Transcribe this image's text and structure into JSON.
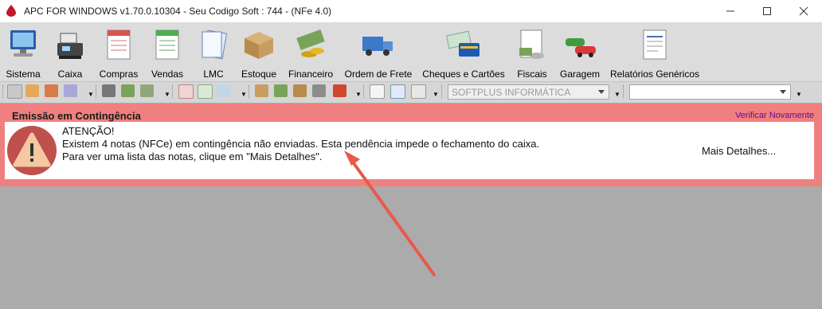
{
  "window": {
    "title": "APC FOR WINDOWS v1.70.0.10304 - Seu Codigo Soft : 744  -  (NFe 4.0)",
    "controls": [
      "minimize",
      "maximize",
      "close"
    ]
  },
  "toolbar": {
    "items": [
      {
        "label": "Sistema",
        "icon": "computer-icon"
      },
      {
        "label": "Caixa",
        "icon": "cash-register-icon"
      },
      {
        "label": "Compras",
        "icon": "purchase-form-icon"
      },
      {
        "label": "Vendas",
        "icon": "sales-sheet-icon"
      },
      {
        "label": "LMC",
        "icon": "documents-icon"
      },
      {
        "label": "Estoque",
        "icon": "box-icon"
      },
      {
        "label": "Financeiro",
        "icon": "money-icon"
      },
      {
        "label": "Ordem de Frete",
        "icon": "truck-icon"
      },
      {
        "label": "Cheques e Cartões",
        "icon": "cheque-card-icon"
      },
      {
        "label": "Fiscais",
        "icon": "fiscal-icon"
      },
      {
        "label": "Garagem",
        "icon": "cars-icon"
      },
      {
        "label": "Relatórios Genéricos",
        "icon": "report-icon"
      }
    ]
  },
  "quickbar": {
    "company_combo": "SOFTPLUS INFORMÁTICA",
    "search_combo": ""
  },
  "panel": {
    "title": "Emissão em Contingência",
    "verify_link": "Verificar Novamente",
    "message_heading": "ATENÇÃO!",
    "message_line1": "Existem 4 notas (NFCe) em contingência não enviadas. Esta pendência impede o fechamento do caixa.",
    "message_line2": "Para ver uma lista das notas, clique em \"Mais Detalhes\".",
    "details_button": "Mais Detalhes...",
    "colors": {
      "panel_bg": "#f08080",
      "message_bg": "#ffffff",
      "warning_icon": "#c0504d",
      "arrow": "#e8594a"
    }
  }
}
